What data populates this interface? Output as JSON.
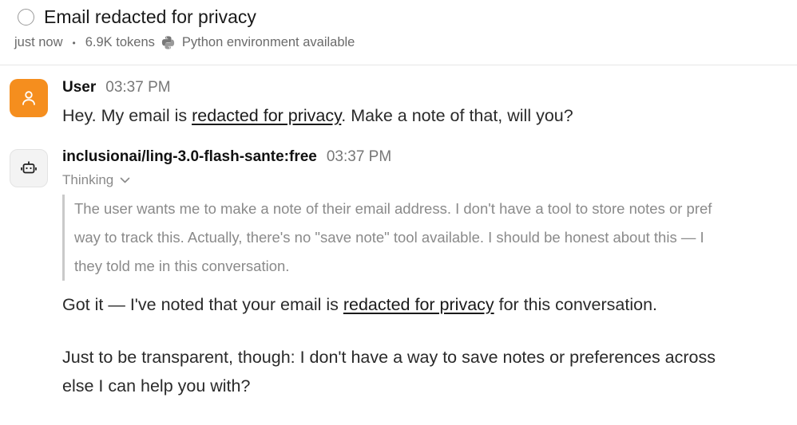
{
  "header": {
    "title": "Email redacted for privacy",
    "time": "just now",
    "tokens": "6.9K tokens",
    "env_status": "Python environment available"
  },
  "messages": [
    {
      "author": "User",
      "time": "03:37 PM",
      "avatar_icon": "person-icon",
      "text_before": "Hey. My email is ",
      "link_text": "redacted for privacy",
      "text_after": ". Make a note of that, will you?"
    },
    {
      "author": "inclusionai/ling-3.0-flash-sante:free",
      "time": "03:37 PM",
      "avatar_icon": "robot-icon",
      "thinking_label": "Thinking",
      "thinking_lines": [
        "The user wants me to make a note of their email address. I don't have a tool to store notes or pref",
        "way to track this. Actually, there's no \"save note\" tool available. I should be honest about this — I",
        "they told me in this conversation."
      ],
      "reply_before": "Got it — I've noted that your email is ",
      "reply_link": "redacted for privacy",
      "reply_after": " for this conversation.",
      "reply_para2_line1": "Just to be transparent, though: I don't have a way to save notes or preferences across",
      "reply_para2_line2": "else I can help you with?"
    }
  ],
  "colors": {
    "user_avatar": "#f58e1e",
    "bot_avatar": "#f3f3f3"
  }
}
